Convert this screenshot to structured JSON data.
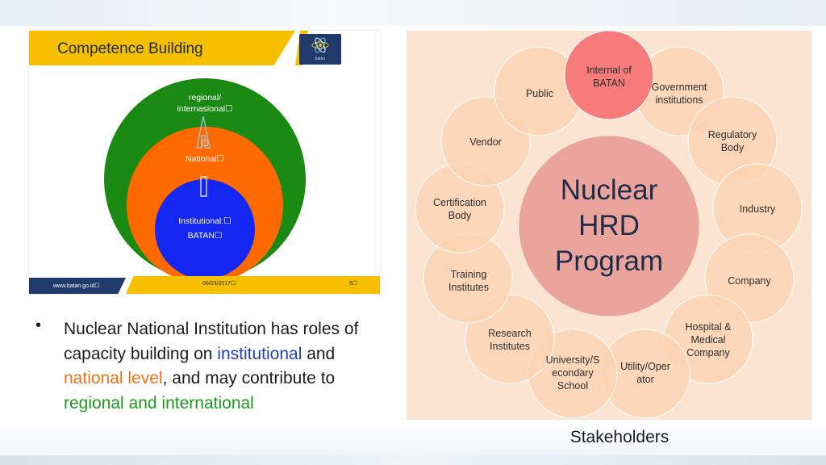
{
  "slide": {
    "title": "Competence Building",
    "logo_text": "batan",
    "circles": {
      "outer": "regional/ internasional☐",
      "middle_icon": "☐",
      "middle": "National☐",
      "inner_line1": "Institutional:☐",
      "inner_line2": "BATAN☐"
    },
    "footer": {
      "url": "www.batan.go.id☐",
      "date": "06/03/2017☐",
      "page": "5☐"
    },
    "colors": {
      "outer": "#1b8a12",
      "middle": "#ff6a00",
      "inner": "#1426f2",
      "header": "#f6c000",
      "navy": "#1f3a6b"
    }
  },
  "bullet": {
    "seg1": "Nuclear National Institution has roles of capacity building on ",
    "seg2": "institutional",
    "seg3": " and ",
    "seg4": "national level",
    "seg5": ", and may contribute to ",
    "seg6": "regional and international"
  },
  "diagram": {
    "center": [
      "Nuclear",
      "HRD",
      "Program"
    ],
    "stakeholders": [
      {
        "line1": "Internal of",
        "line2": "BATAN"
      },
      {
        "line1": "Government",
        "line2": "institutions"
      },
      {
        "line1": "Regulatory",
        "line2": "Body"
      },
      {
        "line1": "Industry",
        "line2": ""
      },
      {
        "line1": "Company",
        "line2": ""
      },
      {
        "line1": "Hospital &",
        "line2": "Medical",
        "line3": "Company"
      },
      {
        "line1": "Utility/Oper",
        "line2": "ator"
      },
      {
        "line1": "University/S",
        "line2": "econdary",
        "line3": "School"
      },
      {
        "line1": "Research",
        "line2": "Institutes"
      },
      {
        "line1": "Training",
        "line2": "Institutes"
      },
      {
        "line1": "Certification",
        "line2": "Body"
      },
      {
        "line1": "Vendor",
        "line2": ""
      },
      {
        "line1": "Public",
        "line2": ""
      }
    ],
    "caption": "Stakeholders",
    "colors": {
      "highlight": "#f87b7b",
      "petal": "#fcd3b3",
      "center": "#eba49b"
    }
  }
}
